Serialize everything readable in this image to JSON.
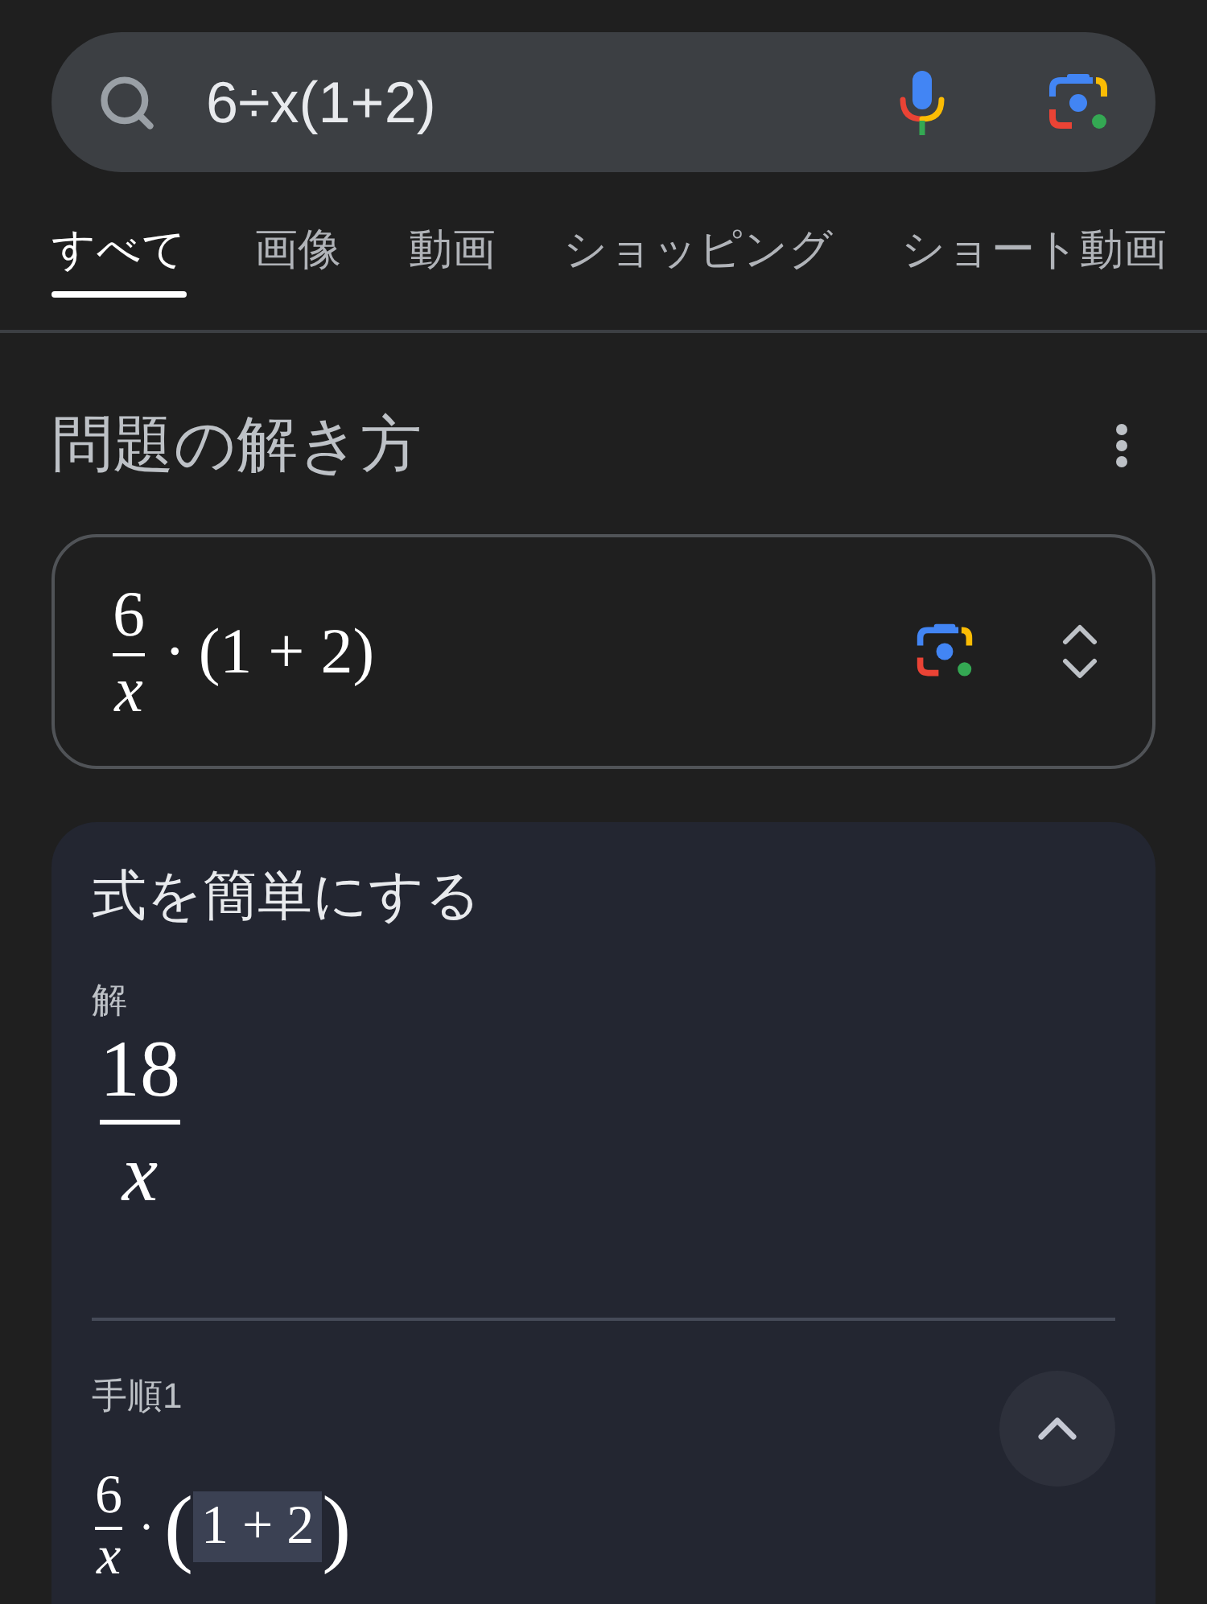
{
  "search": {
    "value": "6÷x(1+2)"
  },
  "tabs": [
    {
      "label": "すべて",
      "selected": true
    },
    {
      "label": "画像",
      "selected": false
    },
    {
      "label": "動画",
      "selected": false
    },
    {
      "label": "ショッピング",
      "selected": false
    },
    {
      "label": "ショート動画",
      "selected": false
    }
  ],
  "solver": {
    "title": "問題の解き方",
    "problem": {
      "numerator": "6",
      "denominator": "x",
      "operator": "·",
      "rest": "(1 + 2)"
    }
  },
  "result": {
    "title": "式を簡単にする",
    "answer_label": "解",
    "answer": {
      "numerator": "18",
      "denominator": "x"
    },
    "steps": [
      {
        "label": "手順1",
        "expanded": true,
        "expression": {
          "numerator": "6",
          "denominator": "x",
          "operator": "·",
          "open": "(",
          "highlight": "1 + 2",
          "close": ")"
        }
      }
    ]
  }
}
